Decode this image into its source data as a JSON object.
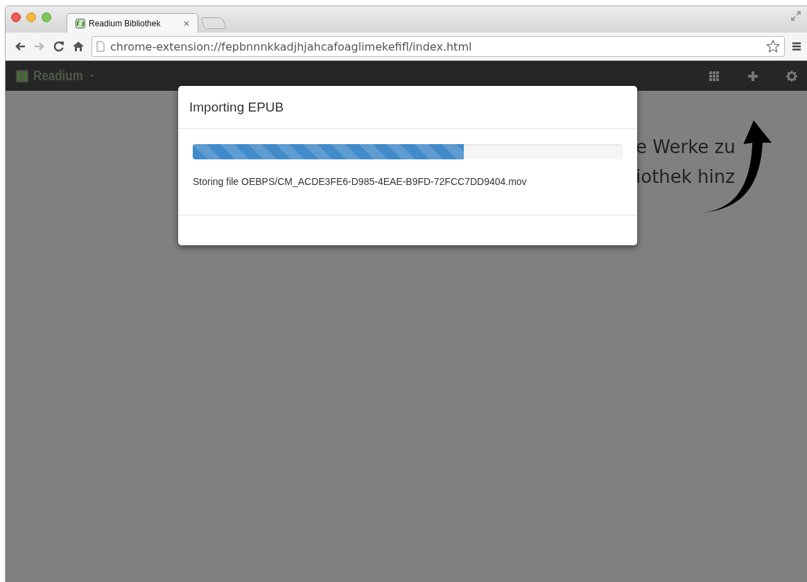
{
  "tab": {
    "title": "Readium Bibliothek",
    "selected": true
  },
  "address": {
    "url": "chrome-extension://fepbnnnkkadjhjahcafoaglimekefifl/index.html"
  },
  "app": {
    "brand": "Readium"
  },
  "hint": [
    "e Werke zu",
    "iothek hinz"
  ],
  "dialog": {
    "title": "Importing EPUB",
    "progress": {
      "level": 0.63
    },
    "status": "Storing file OEBPS/CM_ACDE3FE6-D985-4EAE-B9FD-72FCC7DD9404.mov"
  }
}
